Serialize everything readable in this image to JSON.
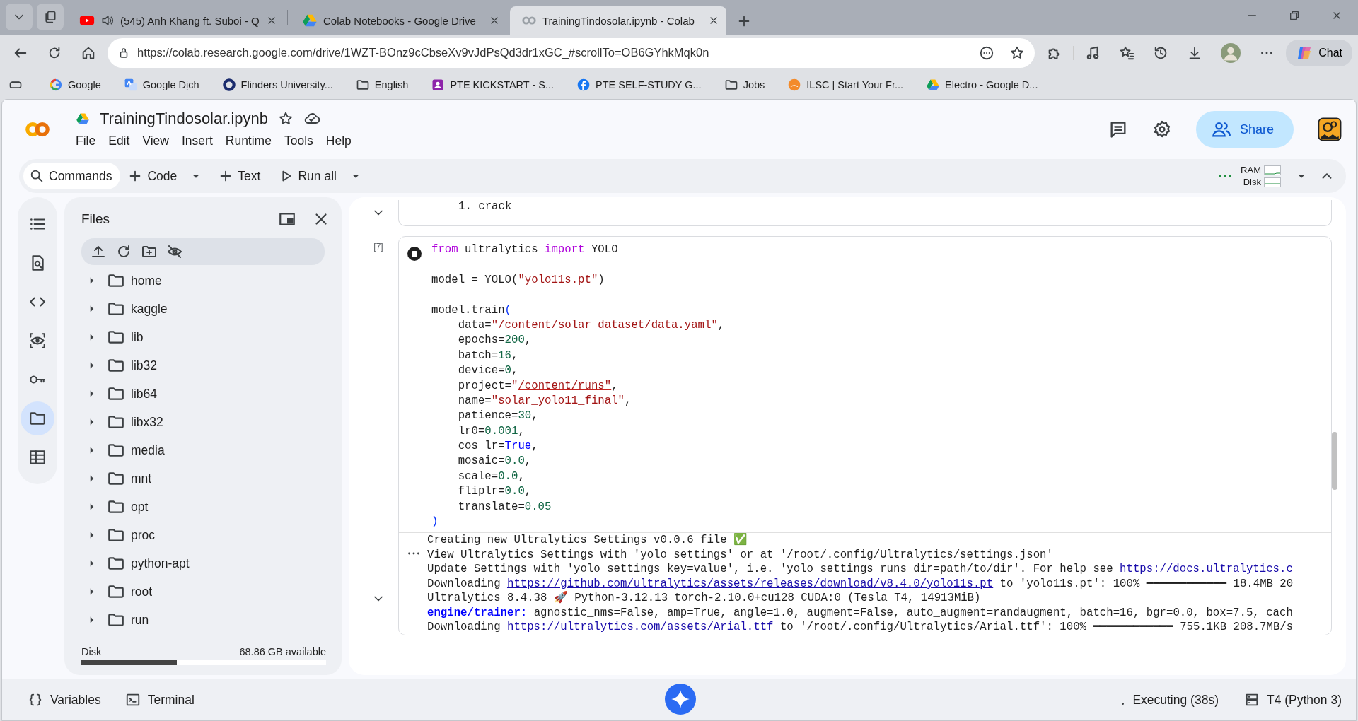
{
  "browser": {
    "tabs": [
      {
        "kind": "youtube",
        "title": "(545) Anh Khang ft. Suboi - Q",
        "audio": true,
        "selected": false
      },
      {
        "kind": "drive",
        "title": "Colab Notebooks - Google Drive",
        "audio": false,
        "selected": false
      },
      {
        "kind": "colab",
        "title": "TrainingTindosolar.ipynb - Colab",
        "audio": false,
        "selected": true
      }
    ],
    "address": "https://colab.research.google.com/drive/1WZT-BOnz9cCbseXv9vJdPsQd3dr1xGC_#scrollTo=OB6GYhkMqk0n",
    "chat_button": "Chat",
    "bookmarks": [
      {
        "kind": "google",
        "label": "Google"
      },
      {
        "kind": "translate",
        "label": "Google Dịch"
      },
      {
        "kind": "ring",
        "label": "Flinders University..."
      },
      {
        "kind": "folder",
        "label": "English"
      },
      {
        "kind": "app",
        "label": "PTE KICKSTART - S..."
      },
      {
        "kind": "facebook",
        "label": "PTE SELF-STUDY G..."
      },
      {
        "kind": "folder",
        "label": "Jobs"
      },
      {
        "kind": "badge",
        "label": "ILSC | Start Your Fr..."
      },
      {
        "kind": "drive",
        "label": "Electro - Google D..."
      }
    ]
  },
  "notebook_header": {
    "title": "TrainingTindosolar.ipynb",
    "menu": [
      "File",
      "Edit",
      "View",
      "Insert",
      "Runtime",
      "Tools",
      "Help"
    ],
    "share_button": "Share"
  },
  "toolbar": {
    "buttons": [
      {
        "kind": "search",
        "label": "Commands",
        "dropdown": false
      },
      {
        "kind": "add",
        "label": "Code",
        "dropdown": true
      },
      {
        "kind": "add",
        "label": "Text",
        "dropdown": false
      },
      {
        "kind": "run",
        "label": "Run all",
        "dropdown": true
      }
    ],
    "resources": [
      "RAM",
      "Disk"
    ]
  },
  "side_nav": [
    {
      "kind": "toc",
      "selected": false
    },
    {
      "kind": "find",
      "selected": false
    },
    {
      "kind": "code",
      "selected": false
    },
    {
      "kind": "inspect",
      "selected": false
    },
    {
      "kind": "key",
      "selected": false
    },
    {
      "kind": "folder",
      "selected": true
    },
    {
      "kind": "table",
      "selected": false
    }
  ],
  "files": {
    "title": "Files",
    "folders": [
      {
        "name": "home",
        "expanded": false
      },
      {
        "name": "kaggle",
        "expanded": false
      },
      {
        "name": "lib",
        "expanded": false
      },
      {
        "name": "lib32",
        "expanded": false
      },
      {
        "name": "lib64",
        "expanded": false
      },
      {
        "name": "libx32",
        "expanded": false
      },
      {
        "name": "media",
        "expanded": false
      },
      {
        "name": "mnt",
        "expanded": false
      },
      {
        "name": "opt",
        "expanded": false
      },
      {
        "name": "proc",
        "expanded": false
      },
      {
        "name": "python-apt",
        "expanded": false
      },
      {
        "name": "root",
        "expanded": false
      },
      {
        "name": "run",
        "expanded": false
      }
    ],
    "disk": {
      "label": "Disk",
      "available": "68.86 GB available",
      "level": 0.39
    }
  },
  "cells": [
    {
      "kind": "text",
      "lines": [
        "1. crack"
      ]
    },
    {
      "kind": "code",
      "execution_count": "[7]",
      "running": true,
      "lines": [
        [
          {
            "kind": "keyword",
            "text": "from"
          },
          " ultralytics ",
          {
            "kind": "keyword",
            "text": "import"
          },
          " YOLO"
        ],
        {
          "kind": "blank"
        },
        [
          "model = YOLO(",
          {
            "kind": "string",
            "text": "\"yolo11s.pt\""
          },
          ")"
        ],
        {
          "kind": "blank"
        },
        [
          "model.train",
          {
            "kind": "bracket",
            "text": "("
          }
        ],
        [
          "    data=",
          {
            "kind": "string",
            "text": "\""
          },
          {
            "kind": "path",
            "text": "/content/solar_dataset/data.yaml\""
          },
          ","
        ],
        [
          "    epochs=",
          {
            "kind": "number",
            "text": "200"
          },
          ","
        ],
        [
          "    batch=",
          {
            "kind": "number",
            "text": "16"
          },
          ","
        ],
        [
          "    device=",
          {
            "kind": "number",
            "text": "0"
          },
          ","
        ],
        [
          "    project=",
          {
            "kind": "string",
            "text": "\""
          },
          {
            "kind": "path",
            "text": "/content/runs\""
          },
          ","
        ],
        [
          "    name=",
          {
            "kind": "string",
            "text": "\"solar_yolo11_final\""
          },
          ","
        ],
        [
          "    patience=",
          {
            "kind": "number",
            "text": "30"
          },
          ","
        ],
        [
          "    lr0=",
          {
            "kind": "number",
            "text": "0.001"
          },
          ","
        ],
        [
          "    cos_lr=",
          {
            "kind": "constant",
            "text": "True"
          },
          ","
        ],
        [
          "    mosaic=",
          {
            "kind": "number",
            "text": "0.0"
          },
          ","
        ],
        [
          "    scale=",
          {
            "kind": "number",
            "text": "0.0"
          },
          ","
        ],
        [
          "    fliplr=",
          {
            "kind": "number",
            "text": "0.0"
          },
          ","
        ],
        [
          "    translate=",
          {
            "kind": "number",
            "text": "0.05"
          }
        ],
        [
          {
            "kind": "bracket",
            "text": ")"
          }
        ]
      ],
      "output": [
        [
          "Creating new Ultralytics Settings v0.0.6 file ✅"
        ],
        [
          "View Ultralytics Settings with 'yolo settings' or at '/root/.config/Ultralytics/settings.json'"
        ],
        [
          "Update Settings with 'yolo settings key=value', i.e. 'yolo settings runs_dir=path/to/dir'. For help see ",
          {
            "kind": "link",
            "text": "https://docs.ultralytics.c"
          }
        ],
        [
          "Downloading ",
          {
            "kind": "link",
            "text": "https://github.com/ultralytics/assets/releases/download/v8.4.0/yolo11s.pt"
          },
          " to 'yolo11s.pt': 100% ━━━━━━━━━━━━ 18.4MB 20"
        ],
        [
          "Ultralytics 8.4.38 🚀 Python-3.12.13 torch-2.10.0+cu128 CUDA:0 (Tesla T4, 14913MiB)"
        ],
        [
          {
            "kind": "label",
            "text": "engine/trainer:"
          },
          " agnostic_nms=False, amp=True, angle=1.0, augment=False, auto_augment=randaugment, batch=16, bgr=0.0, box=7.5, cach"
        ],
        [
          "Downloading ",
          {
            "kind": "link",
            "text": "https://ultralytics.com/assets/Arial.ttf"
          },
          " to '/root/.config/Ultralytics/Arial.ttf': 100% ━━━━━━━━━━━━ 755.1KB 208.7MB/s"
        ]
      ]
    }
  ],
  "status_bar": {
    "variables": "Variables",
    "terminal": "Terminal",
    "execution": "Executing (38s)",
    "runtime": "T4 (Python 3)"
  }
}
